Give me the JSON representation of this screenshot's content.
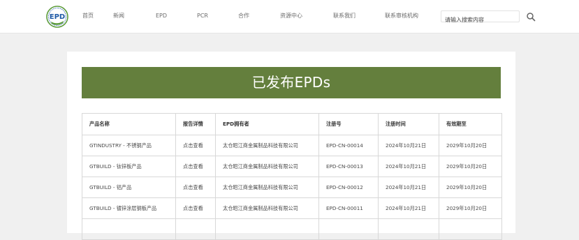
{
  "logo": {
    "text": "EPD"
  },
  "nav": {
    "items": [
      {
        "label": "首页"
      },
      {
        "label": "新闻"
      },
      {
        "label": "EPD"
      },
      {
        "label": "PCR"
      },
      {
        "label": "合作"
      },
      {
        "label": "资源中心"
      },
      {
        "label": "联系我们"
      },
      {
        "label": "联系审核机构"
      }
    ]
  },
  "search": {
    "placeholder": "请输入搜索内容"
  },
  "page": {
    "title": "已发布EPDs"
  },
  "table": {
    "headers": [
      "产品名称",
      "报告详情",
      "EPD拥有者",
      "注册号",
      "注册时间",
      "有效期至"
    ],
    "rows": [
      [
        "GTINDUSTRY - 不锈钢产品",
        "点击查看",
        "太仓昭江商金属制品科技有限公司",
        "EPD-CN-00014",
        "2024年10月21日",
        "2029年10月20日"
      ],
      [
        "GTBUILD - 钛锌板产品",
        "点击查看",
        "太仓昭江商金属制品科技有限公司",
        "EPD-CN-00013",
        "2024年10月21日",
        "2029年10月20日"
      ],
      [
        "GTBUILD - 铝产品",
        "点击查看",
        "太仓昭江商金属制品科技有限公司",
        "EPD-CN-00012",
        "2024年10月21日",
        "2029年10月20日"
      ],
      [
        "GTBUILD - 镀锌涂层钢板产品",
        "点击查看",
        "太仓昭江商金属制品科技有限公司",
        "EPD-CN-00011",
        "2024年10月21日",
        "2029年10月20日"
      ],
      [
        "",
        "",
        "",
        "",
        "",
        ""
      ]
    ]
  },
  "colors": {
    "banner": "#647f3d",
    "logo_blue": "#1f5aa6",
    "logo_green": "#5c9b3a"
  }
}
